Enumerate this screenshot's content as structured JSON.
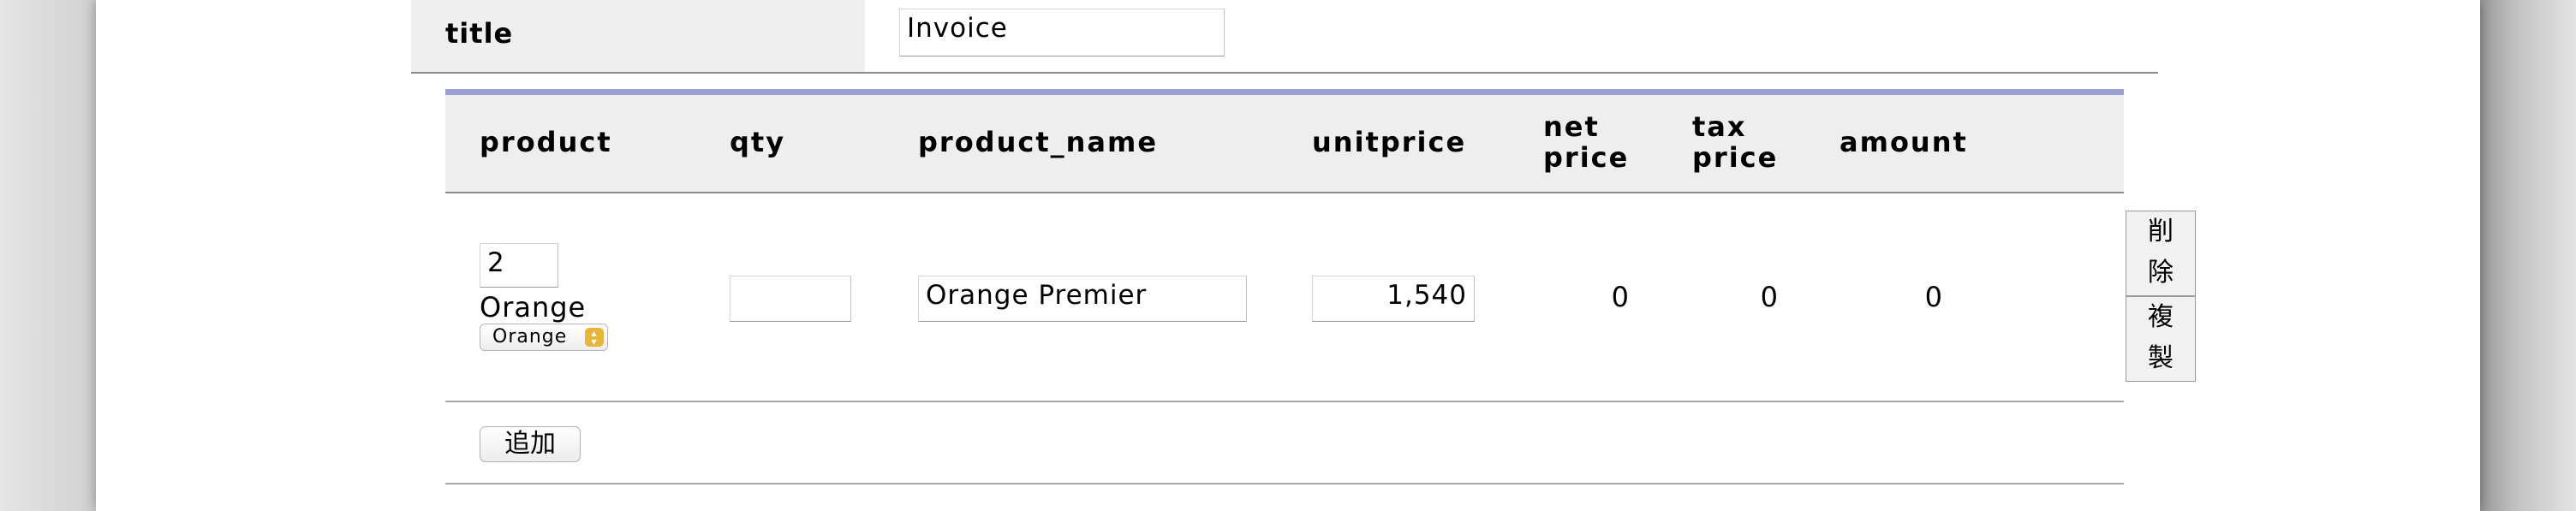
{
  "form": {
    "title_label": "title",
    "title_value": "Invoice"
  },
  "table": {
    "headers": {
      "product": "product",
      "qty": "qty",
      "product_name": "product_name",
      "unitprice": "unitprice",
      "net_price": "net\nprice",
      "tax_price": "tax\nprice",
      "amount": "amount"
    },
    "rows": [
      {
        "product_id": "2",
        "product_label": "Orange",
        "product_select": "Orange",
        "qty": "",
        "product_name": "Orange Premier",
        "unitprice": "1,540",
        "net_price": "0",
        "tax_price": "0",
        "amount": "0",
        "delete_label": "削\n除",
        "duplicate_label": "複\n製"
      }
    ],
    "add_label": "追加"
  },
  "icons": {
    "select_arrows": "up-down-chevron-icon"
  },
  "colors": {
    "header_accent": "#9c9fd1",
    "header_bg": "#eeeeee",
    "select_accent": "#e6b53c"
  }
}
